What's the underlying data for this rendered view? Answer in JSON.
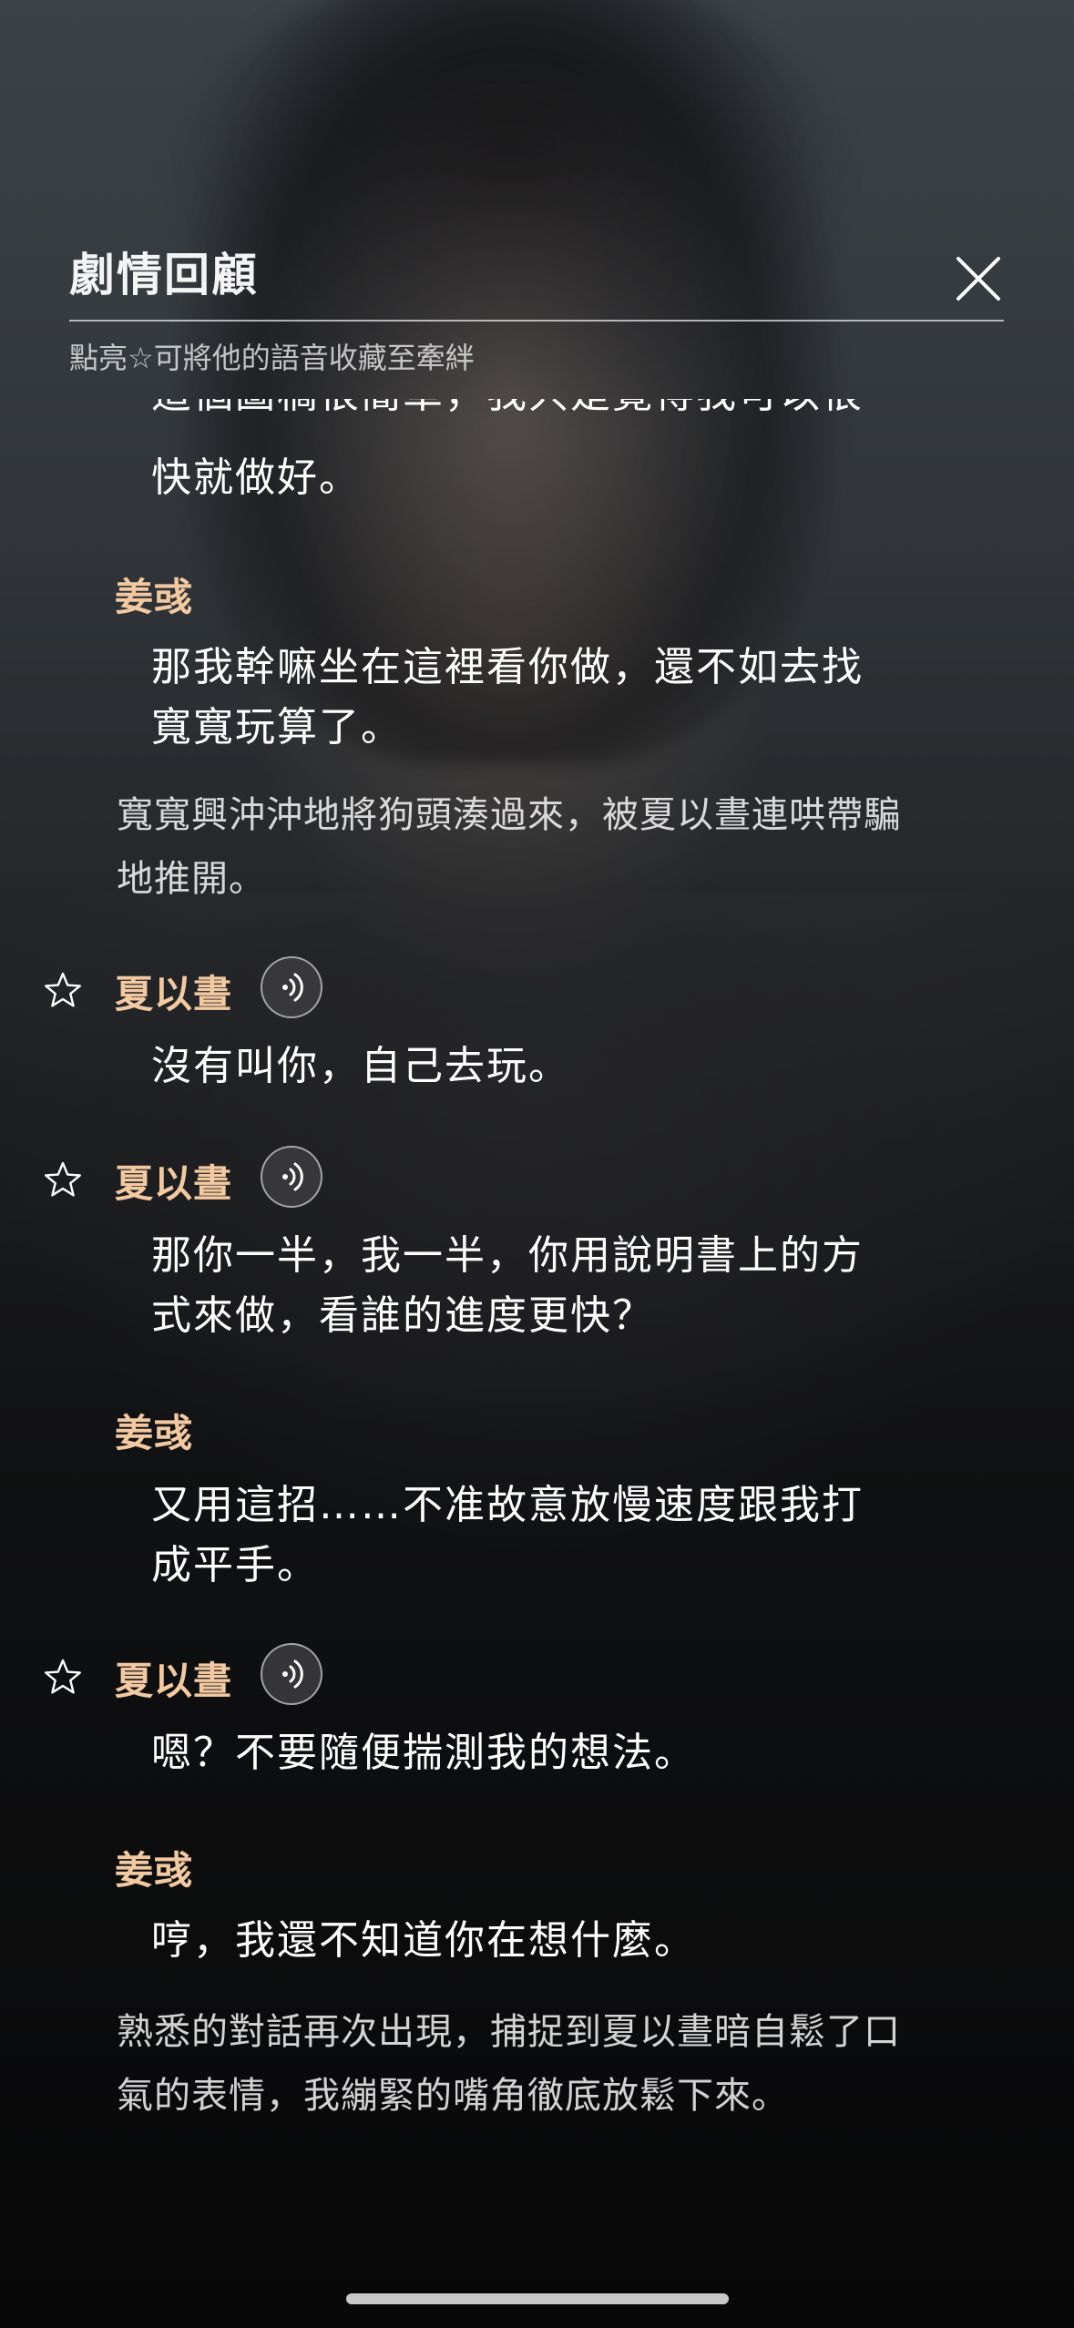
{
  "header": {
    "title": "劇情回顧",
    "subtitle": "點亮☆可將他的語音收藏至牽絆"
  },
  "log": {
    "partial_top_line_cut": "這個圖稿很簡單，我只是覺得我可以很",
    "partial_top_line": "快就做好。",
    "entries": [
      {
        "speaker": "姜彧",
        "text_lines": [
          "那我幹嘛坐在這裡看你做，還不如去找",
          "寬寬玩算了。"
        ]
      },
      {
        "narration_lines": [
          "寬寬興沖沖地將狗頭湊過來，被夏以晝連哄帶騙",
          "地推開。"
        ]
      },
      {
        "speaker": "夏以晝",
        "text_lines": [
          "沒有叫你，自己去玩。"
        ]
      },
      {
        "speaker": "夏以晝",
        "text_lines": [
          "那你一半，我一半，你用說明書上的方",
          "式來做，看誰的進度更快？"
        ]
      },
      {
        "speaker": "姜彧",
        "text_lines": [
          "又用這招……不准故意放慢速度跟我打",
          "成平手。"
        ]
      },
      {
        "speaker": "夏以晝",
        "text_lines": [
          "嗯？不要隨便揣測我的想法。"
        ]
      },
      {
        "speaker": "姜彧",
        "text_lines": [
          "哼，我還不知道你在想什麼。"
        ]
      },
      {
        "narration_lines": [
          "熟悉的對話再次出現，捕捉到夏以晝暗自鬆了口",
          "氣的表情，我繃緊的嘴角徹底放鬆下來。"
        ]
      }
    ]
  },
  "icons": {
    "close": "close-icon",
    "star": "star-outline-icon",
    "voice": "voice-play-icon"
  },
  "colors": {
    "speaker_name": "#f2c9a1",
    "text": "#ffffff"
  }
}
